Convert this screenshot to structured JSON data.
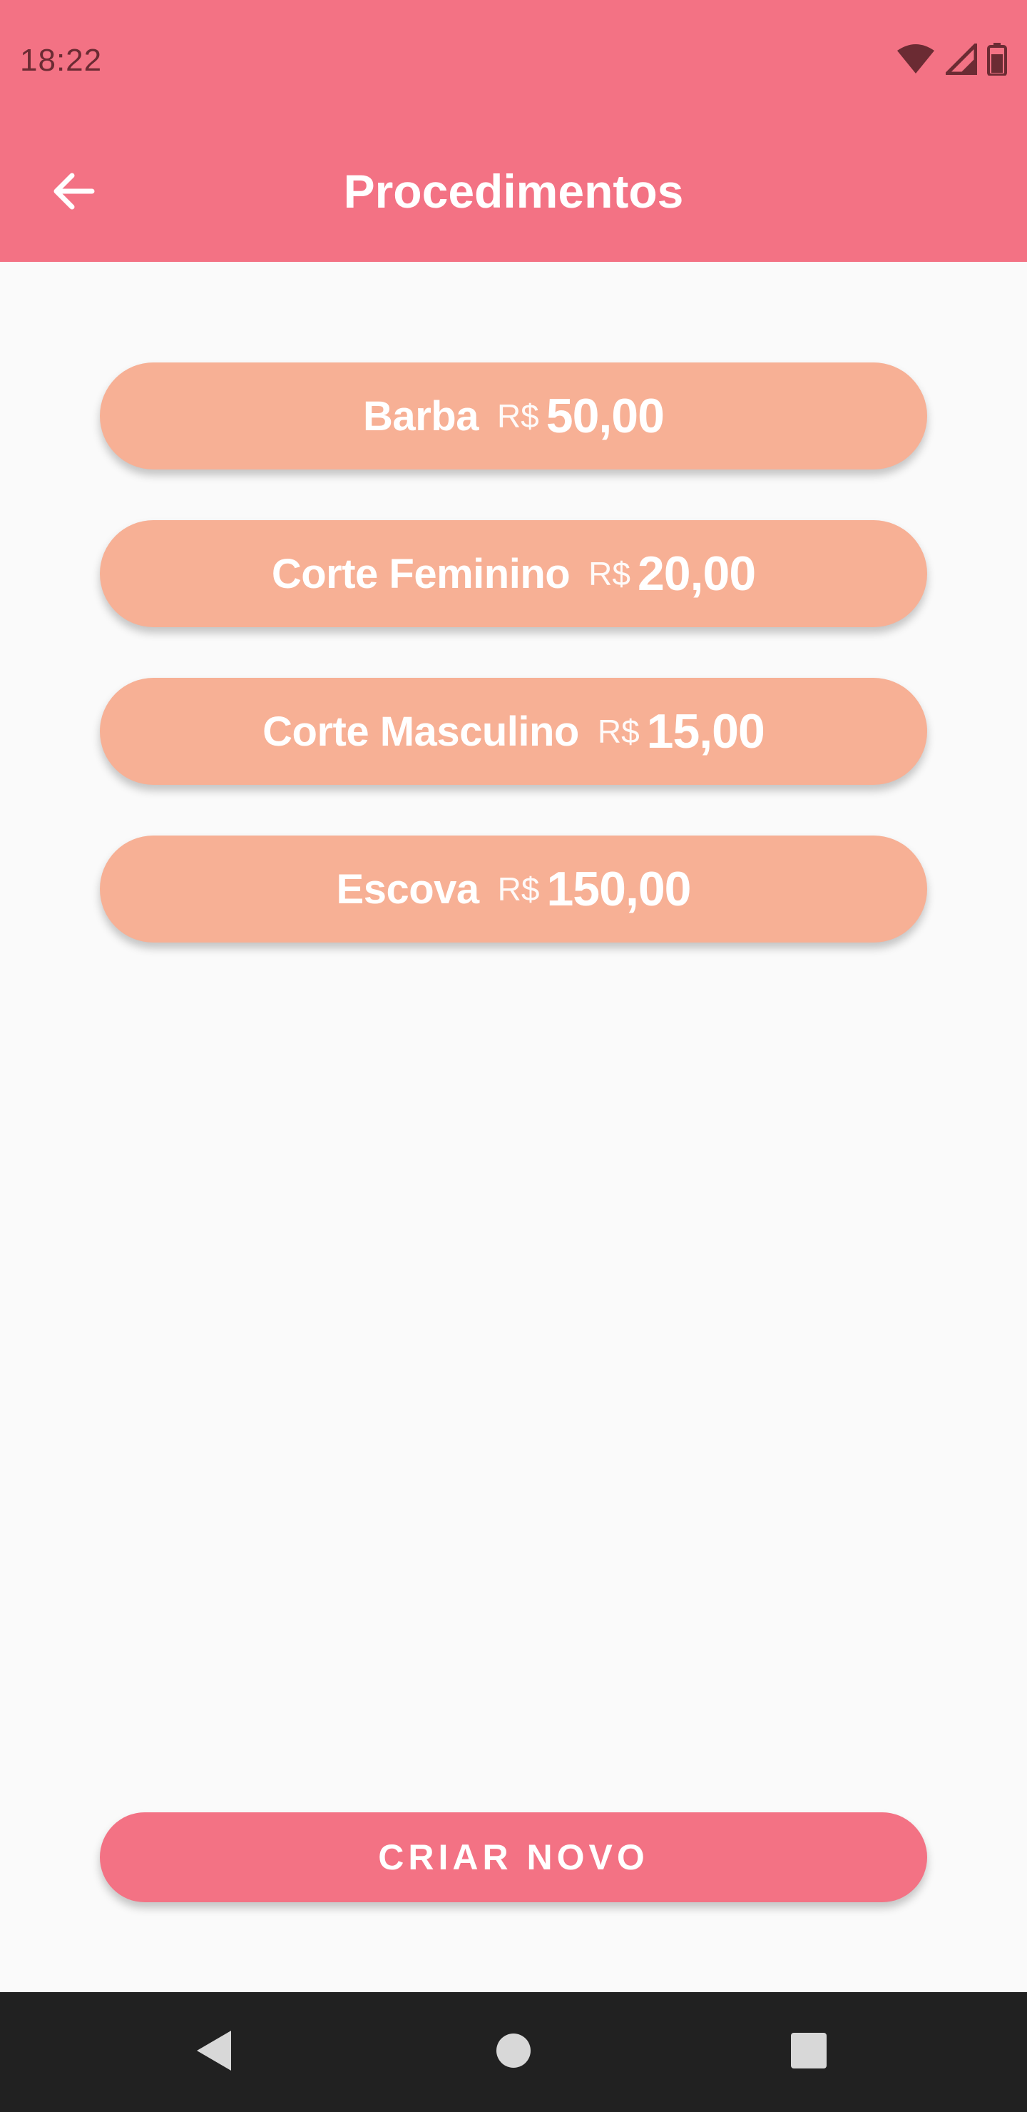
{
  "status_bar": {
    "time": "18:22",
    "icons": [
      "wifi-icon",
      "cell-signal-icon",
      "battery-icon"
    ]
  },
  "app_bar": {
    "title": "Procedimentos",
    "back_icon": "arrow-back-icon"
  },
  "procedures": [
    {
      "name": "Barba",
      "currency": "R$",
      "price": "50,00"
    },
    {
      "name": "Corte Feminino",
      "currency": "R$",
      "price": "20,00"
    },
    {
      "name": "Corte Masculino",
      "currency": "R$",
      "price": "15,00"
    },
    {
      "name": "Escova",
      "currency": "R$",
      "price": "150,00"
    }
  ],
  "actions": {
    "create_label": "CRIAR NOVO"
  },
  "nav_bar": {
    "icons": [
      "nav-back-icon",
      "nav-home-icon",
      "nav-recents-icon"
    ]
  },
  "colors": {
    "primary": "#F37284",
    "procedure_button": "#F7B095",
    "background": "#FAFAFA",
    "nav_bar": "#212121"
  }
}
